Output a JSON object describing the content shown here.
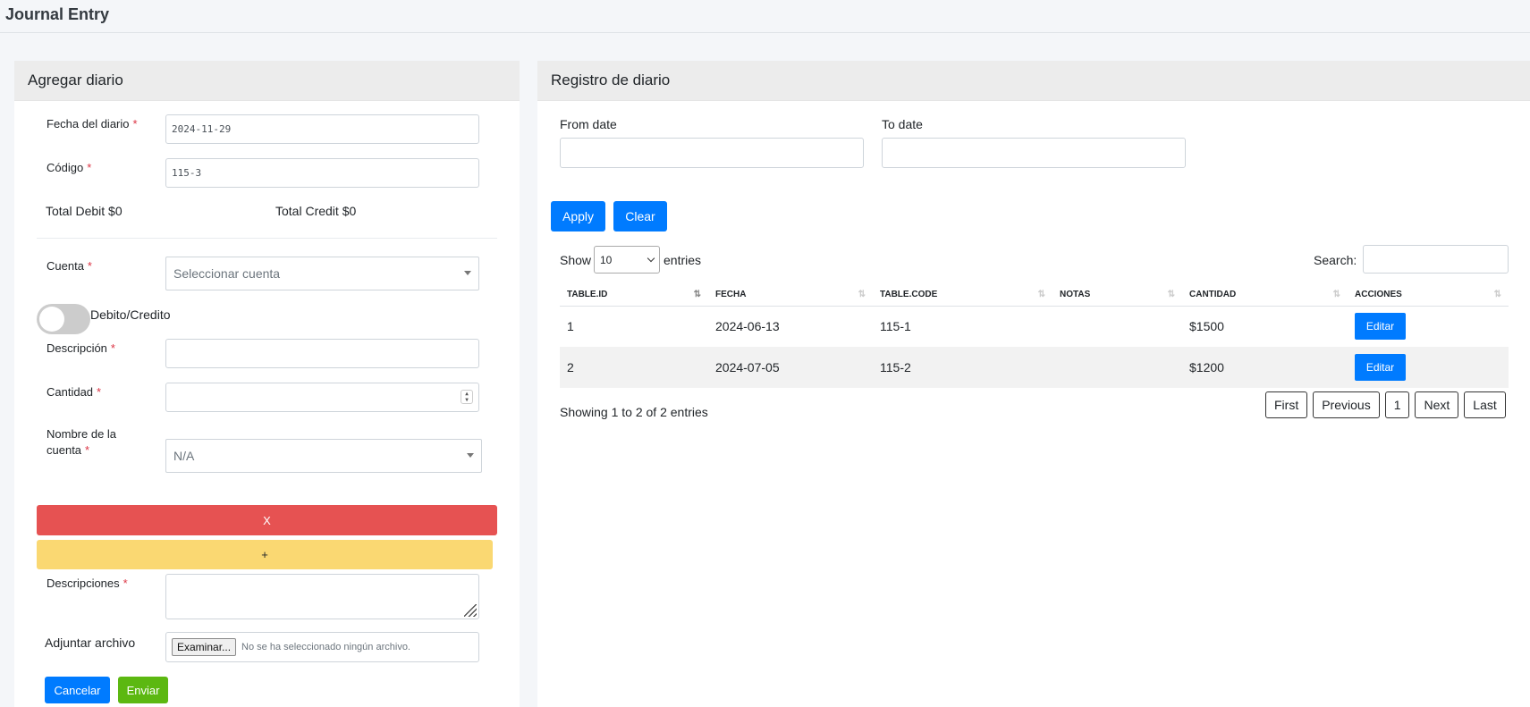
{
  "page": {
    "title": "Journal Entry"
  },
  "left": {
    "header": "Agregar diario",
    "fecha_label": "Fecha del diario",
    "fecha_value": "2024-11-29",
    "codigo_label": "Código",
    "codigo_value": "115-3",
    "total_debit": "Total Debit $0",
    "total_credit": "Total Credit $0",
    "cuenta_label": "Cuenta",
    "cuenta_placeholder": "Seleccionar cuenta",
    "toggle_label": "Debito/Credito",
    "descripcion_label": "Descripción",
    "cantidad_label": "Cantidad",
    "nombre_label_1": "Nombre de la",
    "nombre_label_2": "cuenta",
    "nombre_value": "N/A",
    "remove_label": "X",
    "add_label": "+",
    "descripciones_label": "Descripciones",
    "adjuntar_label": "Adjuntar archivo",
    "file_button": "Examinar...",
    "file_status": "No se ha seleccionado ningún archivo.",
    "cancel_label": "Cancelar",
    "submit_label": "Enviar",
    "required_mark": "*"
  },
  "right": {
    "header": "Registro de diario",
    "from_label": "From date",
    "to_label": "To date",
    "apply_label": "Apply",
    "clear_label": "Clear",
    "show_label": "Show",
    "entries_value": "10",
    "entries_label": "entries",
    "search_label": "Search:",
    "columns": [
      "TABLE.ID",
      "FECHA",
      "TABLE.CODE",
      "NOTAS",
      "CANTIDAD",
      "ACCIONES"
    ],
    "rows": [
      {
        "id": "1",
        "fecha": "2024-06-13",
        "code": "115-1",
        "notas": "",
        "cantidad": "$1500",
        "action": "Editar"
      },
      {
        "id": "2",
        "fecha": "2024-07-05",
        "code": "115-2",
        "notas": "",
        "cantidad": "$1200",
        "action": "Editar"
      }
    ],
    "info": "Showing 1 to 2 of 2 entries",
    "pager": {
      "first": "First",
      "previous": "Previous",
      "page": "1",
      "next": "Next",
      "last": "Last"
    }
  },
  "colors": {
    "primary": "#007bff",
    "success": "#5cb811",
    "danger": "#e65252",
    "warning": "#fad872"
  }
}
